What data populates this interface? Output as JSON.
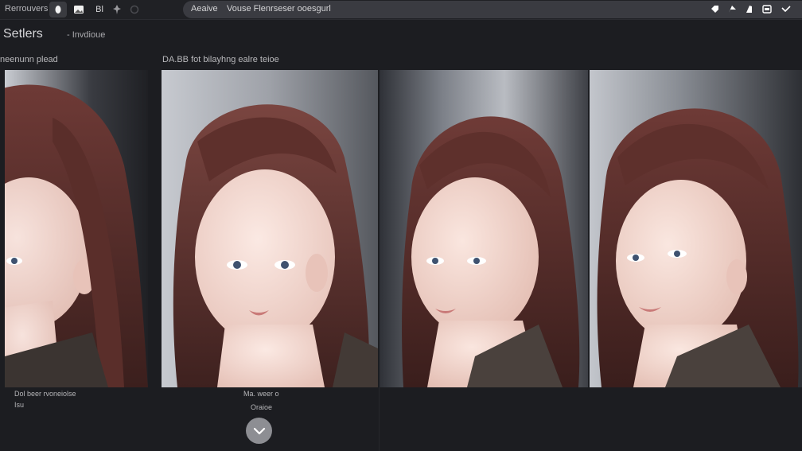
{
  "topbar": {
    "app_name": "Rerrouvers",
    "tool_label": "Bl",
    "search": {
      "label": "Aeaive",
      "text": "Vouse Flenrseser ooesgurl"
    }
  },
  "page": {
    "title": "Setlers",
    "subtitle": "- Invdioue"
  },
  "panels": [
    {
      "label": "neenunn plead",
      "caption1": "Dol beer rvoneiolse",
      "caption2": "Isu"
    },
    {
      "label": "DA.BB fot bilayhng ealre teioe",
      "caption1": "Ma. weer o",
      "caption2": "Oraioe"
    },
    {
      "label": ""
    },
    {
      "label": ""
    }
  ],
  "colors": {
    "background": "#1c1d21",
    "topbar": "#202125",
    "search_bg": "#3a3b41",
    "confirm_button": "#8d8e93",
    "hair": "#5a2e2a"
  },
  "icons": [
    "record-icon",
    "image-icon",
    "pin-icon",
    "history-icon",
    "tag-icon",
    "share-icon",
    "edit-icon",
    "window-icon",
    "back-icon",
    "chevron-down-icon"
  ]
}
